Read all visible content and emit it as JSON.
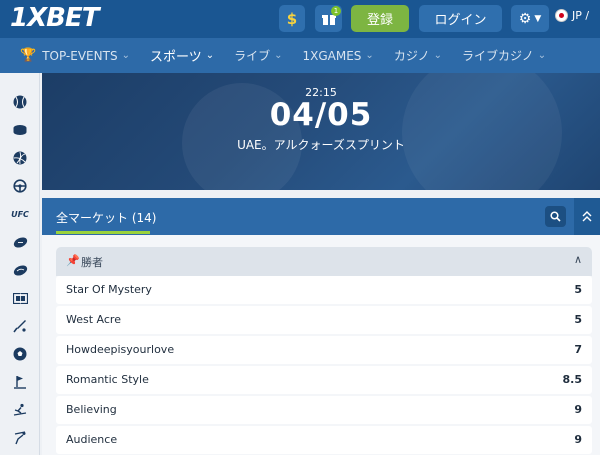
{
  "header": {
    "logo": "1XBET",
    "dollar_icon": "$",
    "gift_badge": "1",
    "register": "登録",
    "login": "ログイン",
    "lang": "JP /"
  },
  "nav": {
    "items": [
      {
        "label": "TOP-EVENTS"
      },
      {
        "label": "スポーツ"
      },
      {
        "label": "ライブ"
      },
      {
        "label": "1XGAMES"
      },
      {
        "label": "カジノ"
      },
      {
        "label": "ライブカジノ"
      }
    ]
  },
  "sidebar": {
    "icons": [
      "baseball-icon",
      "hockey-puck-icon",
      "volleyball-icon",
      "steering-wheel-icon",
      "ufc-icon",
      "american-football-icon",
      "rugby-icon",
      "table-football-icon",
      "cricket-icon",
      "soccer-ball-icon",
      "golf-icon",
      "skiing-icon",
      "ski-jump-icon"
    ],
    "ufc_label": "UFC"
  },
  "hero": {
    "time": "22:15",
    "date": "04/05",
    "title": "UAE。アルクォーズスプリント"
  },
  "market": {
    "tab_label": "全マーケット (14)",
    "group_title": "勝者",
    "rows": [
      {
        "name": "Star Of Mystery",
        "odds": "5"
      },
      {
        "name": "West Acre",
        "odds": "5"
      },
      {
        "name": "Howdeepisyourlove",
        "odds": "7"
      },
      {
        "name": "Romantic Style",
        "odds": "8.5"
      },
      {
        "name": "Believing",
        "odds": "9"
      },
      {
        "name": "Audience",
        "odds": "9"
      }
    ]
  },
  "colors": {
    "header_bg": "#1a5692",
    "nav_bg": "#2d6aa8",
    "register_green": "#7db542",
    "accent_underline": "#9ad23b"
  }
}
